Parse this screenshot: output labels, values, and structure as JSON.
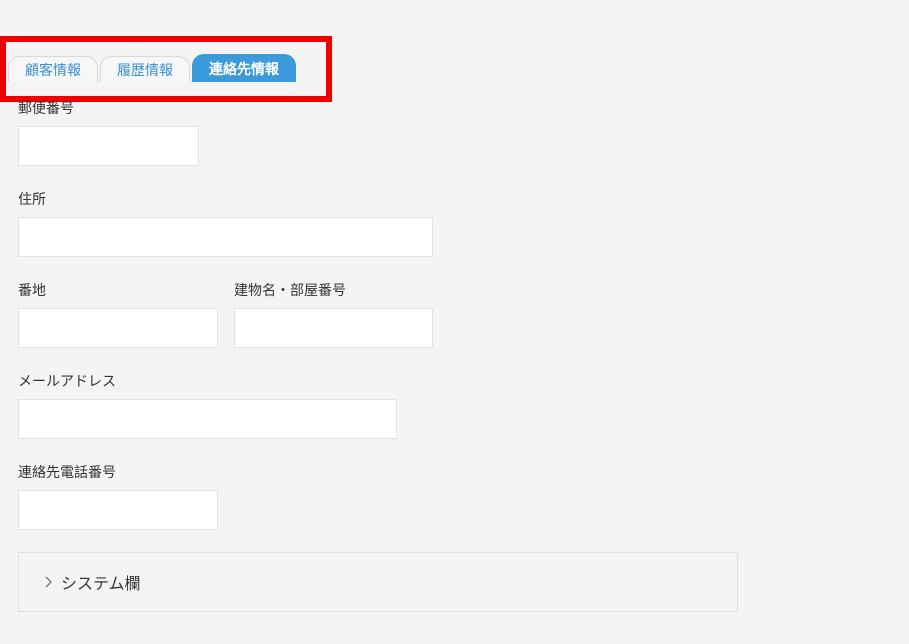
{
  "tabs": [
    {
      "label": "顧客情報",
      "active": false
    },
    {
      "label": "履歴情報",
      "active": false
    },
    {
      "label": "連絡先情報",
      "active": true
    }
  ],
  "form": {
    "postal_code": {
      "label": "郵便番号",
      "value": ""
    },
    "address": {
      "label": "住所",
      "value": ""
    },
    "street_number": {
      "label": "番地",
      "value": ""
    },
    "building": {
      "label": "建物名・部屋番号",
      "value": ""
    },
    "email": {
      "label": "メールアドレス",
      "value": ""
    },
    "contact_phone": {
      "label": "連絡先電話番号",
      "value": ""
    }
  },
  "system_section": {
    "label": "システム欄",
    "icon": "chevron-right-icon",
    "expanded": false
  },
  "colors": {
    "active_tab": "#3b9ad9",
    "tab_text": "#3a8fd0",
    "highlight": "#ee0000",
    "background": "#f4f4f4"
  }
}
